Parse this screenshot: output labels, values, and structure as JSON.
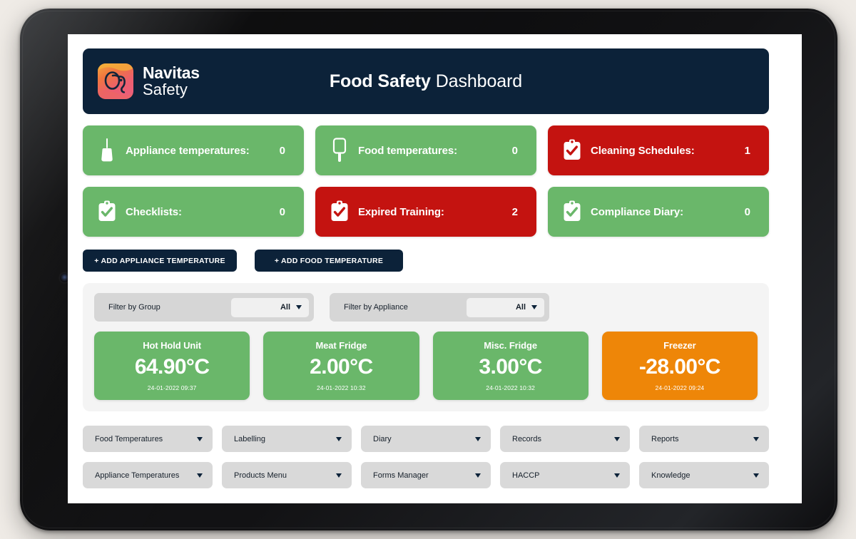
{
  "header": {
    "brand_line1": "Navitas",
    "brand_line2": "Safety",
    "title_bold": "Food Safety",
    "title_light": "Dashboard",
    "logo_icon": "elephant-logo-icon",
    "bg_color": "#0c2239"
  },
  "status_tiles": [
    {
      "label": "Appliance temperatures:",
      "count": "0",
      "state": "green",
      "icon": "probe-thermometer-icon"
    },
    {
      "label": "Food temperatures:",
      "count": "0",
      "state": "green",
      "icon": "paddle-probe-icon"
    },
    {
      "label": "Cleaning Schedules:",
      "count": "1",
      "state": "red",
      "icon": "clipboard-check-icon"
    },
    {
      "label": "Checklists:",
      "count": "0",
      "state": "green",
      "icon": "clipboard-check-icon"
    },
    {
      "label": "Expired Training:",
      "count": "2",
      "state": "red",
      "icon": "clipboard-check-icon"
    },
    {
      "label": "Compliance Diary:",
      "count": "0",
      "state": "green",
      "icon": "clipboard-check-icon"
    }
  ],
  "actions": {
    "add_appliance_temperature": "+ ADD APPLIANCE TEMPERATURE",
    "add_food_temperature": "+ ADD FOOD TEMPERATURE"
  },
  "filters": [
    {
      "label": "Filter by Group",
      "value": "All"
    },
    {
      "label": "Filter by Appliance",
      "value": "All"
    }
  ],
  "temperature_cards": [
    {
      "name": "Hot Hold Unit",
      "value": "64.90°C",
      "timestamp": "24-01-2022 09:37",
      "state": "green"
    },
    {
      "name": "Meat Fridge",
      "value": "2.00°C",
      "timestamp": "24-01-2022 10:32",
      "state": "green"
    },
    {
      "name": "Misc. Fridge",
      "value": "3.00°C",
      "timestamp": "24-01-2022 10:32",
      "state": "green"
    },
    {
      "name": "Freezer",
      "value": "-28.00°C",
      "timestamp": "24-01-2022 09:24",
      "state": "orange"
    }
  ],
  "nav_items": [
    {
      "label": "Food Temperatures"
    },
    {
      "label": "Labelling"
    },
    {
      "label": "Diary"
    },
    {
      "label": "Records"
    },
    {
      "label": "Reports"
    },
    {
      "label": "Appliance Temperatures"
    },
    {
      "label": "Products Menu"
    },
    {
      "label": "Forms Manager"
    },
    {
      "label": "HACCP"
    },
    {
      "label": "Knowledge"
    }
  ],
  "colors": {
    "navy": "#0c2239",
    "green": "#6ab76a",
    "red": "#c41310",
    "orange": "#ee8608",
    "panel": "#f4f4f4"
  }
}
